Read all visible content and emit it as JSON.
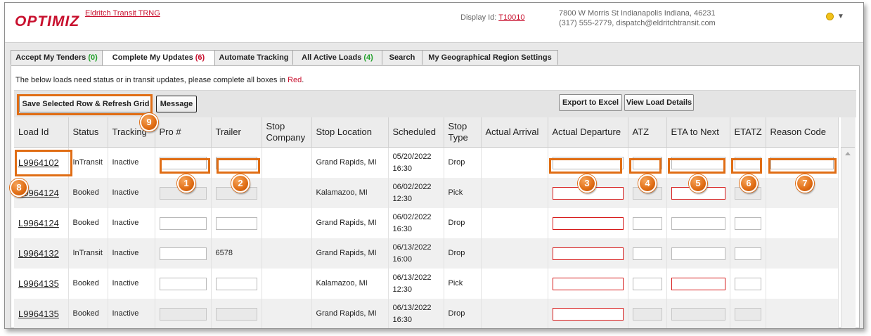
{
  "header": {
    "logo": "OPTIMIZ",
    "company": "Eldritch Transit TRNG",
    "display_id_label": "Display Id: ",
    "display_id_value": "T10010",
    "address_line1": "7800 W Morris St Indianapolis Indiana, 46231",
    "address_line2": "(317) 555-2779, dispatch@eldritchtransit.com",
    "user_menu_arrow": "▼"
  },
  "tabs": [
    {
      "label": "Accept My Tenders",
      "count": "(0)",
      "count_color": "#21a02a",
      "active": false
    },
    {
      "label": "Complete My Updates",
      "count": "(6)",
      "count_color": "#c8102e",
      "active": true
    },
    {
      "label": "Automate Tracking",
      "count": "",
      "active": false
    },
    {
      "label": "All Active Loads",
      "count": "(4)",
      "count_color": "#21a02a",
      "active": false
    },
    {
      "label": "Search",
      "count": "",
      "active": false
    },
    {
      "label": "My Geographical Region Settings",
      "count": "",
      "active": false
    }
  ],
  "note": {
    "text": "The below loads need status or in transit updates, please complete all boxes in ",
    "red_word": "Red",
    "end": "."
  },
  "toolbar": {
    "save_label": "Save Selected Row & Refresh Grid",
    "message_label": "Message",
    "export_label": "Export to Excel",
    "details_label": "View Load Details"
  },
  "columns": [
    "Load Id",
    "Status",
    "Tracking",
    "Pro #",
    "Trailer",
    "Stop Company",
    "Stop Location",
    "Scheduled",
    "Stop Type",
    "Actual Arrival",
    "Actual Departure",
    "ATZ",
    "ETA to Next",
    "ETATZ",
    "Reason Code"
  ],
  "rows": [
    {
      "load_id": "L9964102",
      "status": "InTransit",
      "tracking": "Inactive",
      "trailer": "",
      "location": "Grand Rapids, MI",
      "sched_date": "05/20/2022",
      "sched_time": "16:30",
      "stop_type": "Drop"
    },
    {
      "load_id": "L9964124",
      "status": "Booked",
      "tracking": "Inactive",
      "trailer": "",
      "location": "Kalamazoo, MI",
      "sched_date": "06/02/2022",
      "sched_time": "12:30",
      "stop_type": "Pick"
    },
    {
      "load_id": "L9964124",
      "status": "Booked",
      "tracking": "Inactive",
      "trailer": "",
      "location": "Grand Rapids, MI",
      "sched_date": "06/02/2022",
      "sched_time": "16:30",
      "stop_type": "Drop"
    },
    {
      "load_id": "L9964132",
      "status": "InTransit",
      "tracking": "Inactive",
      "trailer": "6578",
      "location": "Grand Rapids, MI",
      "sched_date": "06/13/2022",
      "sched_time": "16:00",
      "stop_type": "Drop"
    },
    {
      "load_id": "L9964135",
      "status": "Booked",
      "tracking": "Inactive",
      "trailer": "",
      "location": "Kalamazoo, MI",
      "sched_date": "06/13/2022",
      "sched_time": "12:30",
      "stop_type": "Pick"
    },
    {
      "load_id": "L9964135",
      "status": "Booked",
      "tracking": "Inactive",
      "trailer": "",
      "location": "Grand Rapids, MI",
      "sched_date": "06/13/2022",
      "sched_time": "16:30",
      "stop_type": "Drop"
    }
  ],
  "callouts": [
    "1",
    "2",
    "3",
    "4",
    "5",
    "6",
    "7",
    "8",
    "9"
  ],
  "colors": {
    "accent": "#e06d14",
    "brand": "#c8102e",
    "required": "#d61a1a"
  }
}
